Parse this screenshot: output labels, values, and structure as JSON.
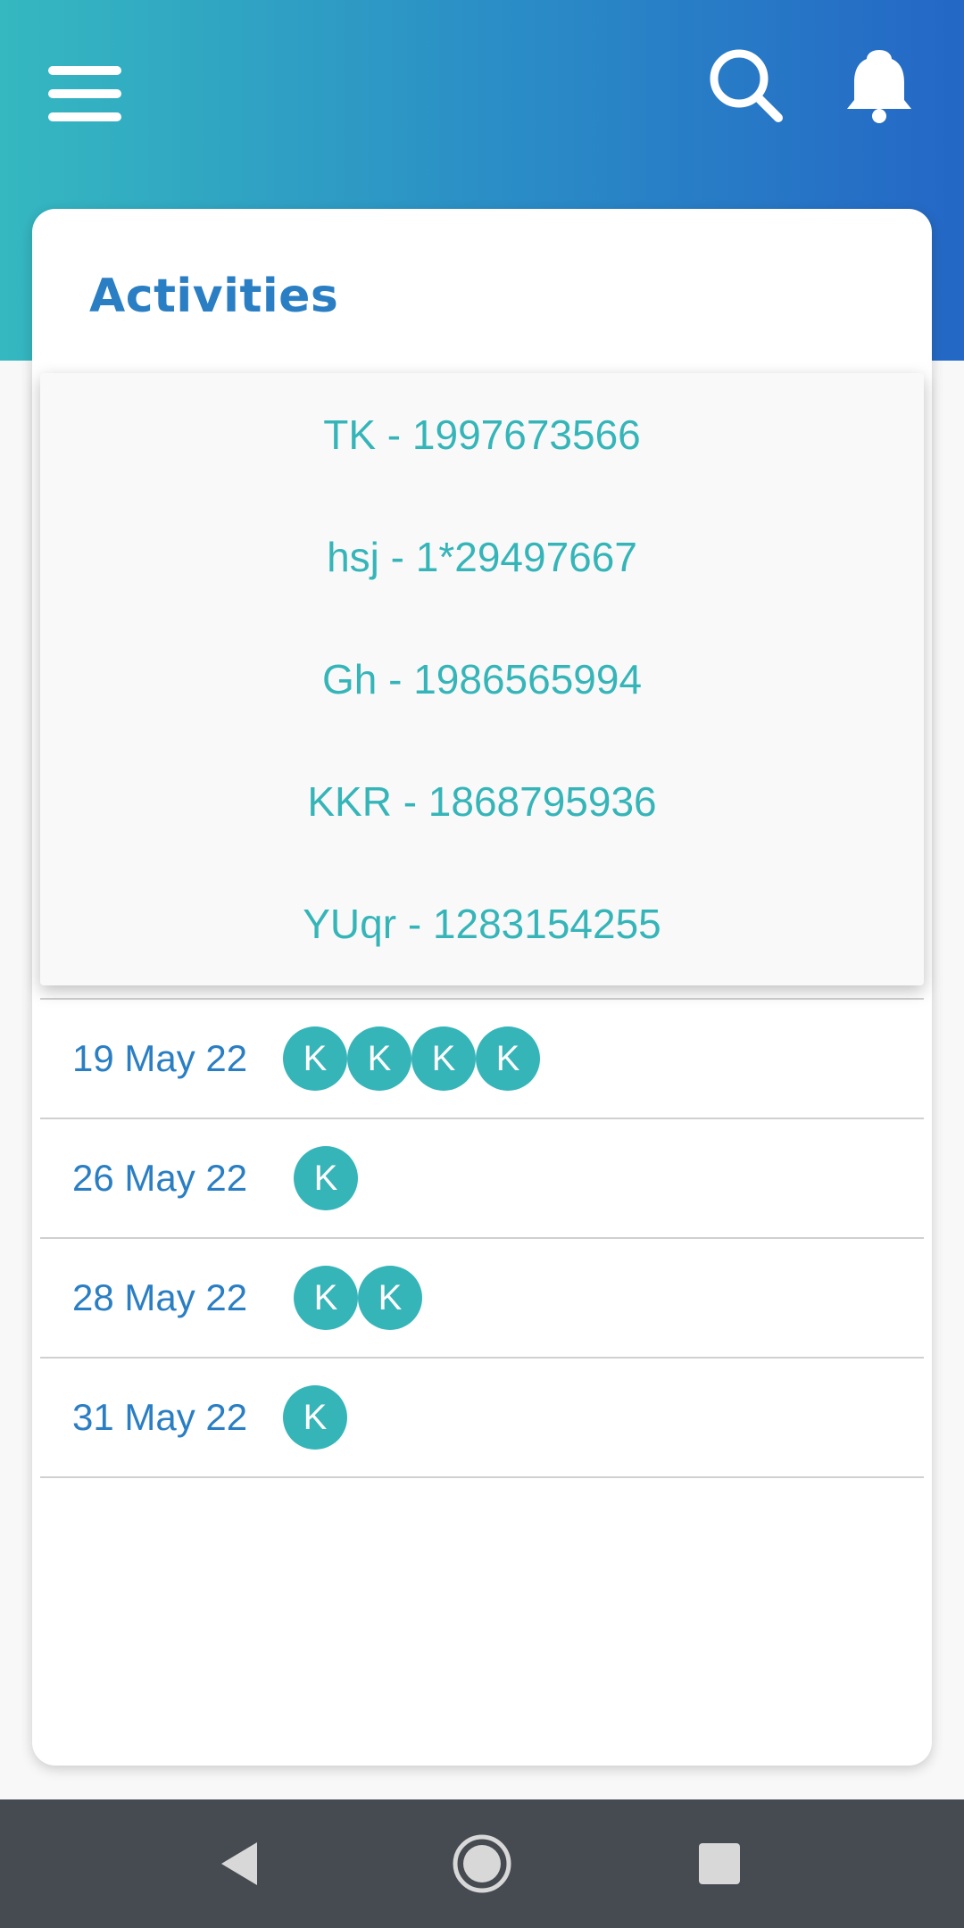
{
  "header": {
    "menu_icon": "hamburger-menu-icon",
    "search_icon": "search-icon",
    "notification_icon": "bell-icon",
    "gradient_start": "#35b8c0",
    "gradient_end": "#2467c6"
  },
  "card": {
    "title": "Activities"
  },
  "dropdown": {
    "items": [
      {
        "label": "TK - 1997673566"
      },
      {
        "label": "hsj - 1*29497667"
      },
      {
        "label": "Gh - 1986565994"
      },
      {
        "label": "KKR - 1868795936"
      },
      {
        "label": "YUqr - 1283154255"
      }
    ]
  },
  "activities": [
    {
      "date": "19 May 22",
      "avatars": [
        "K",
        "K",
        "K",
        "K"
      ]
    },
    {
      "date": "26 May 22",
      "avatars": [
        "K"
      ]
    },
    {
      "date": "28 May 22",
      "avatars": [
        "K",
        "K"
      ]
    },
    {
      "date": "31 May 22",
      "avatars": [
        "K"
      ]
    }
  ],
  "navbar": {
    "back_icon": "back-triangle-icon",
    "home_icon": "home-circle-icon",
    "recent_icon": "recent-apps-square-icon"
  },
  "colors": {
    "accent_teal": "#36b5b9",
    "title_blue": "#2a7ec3",
    "navbar": "#454b51"
  }
}
